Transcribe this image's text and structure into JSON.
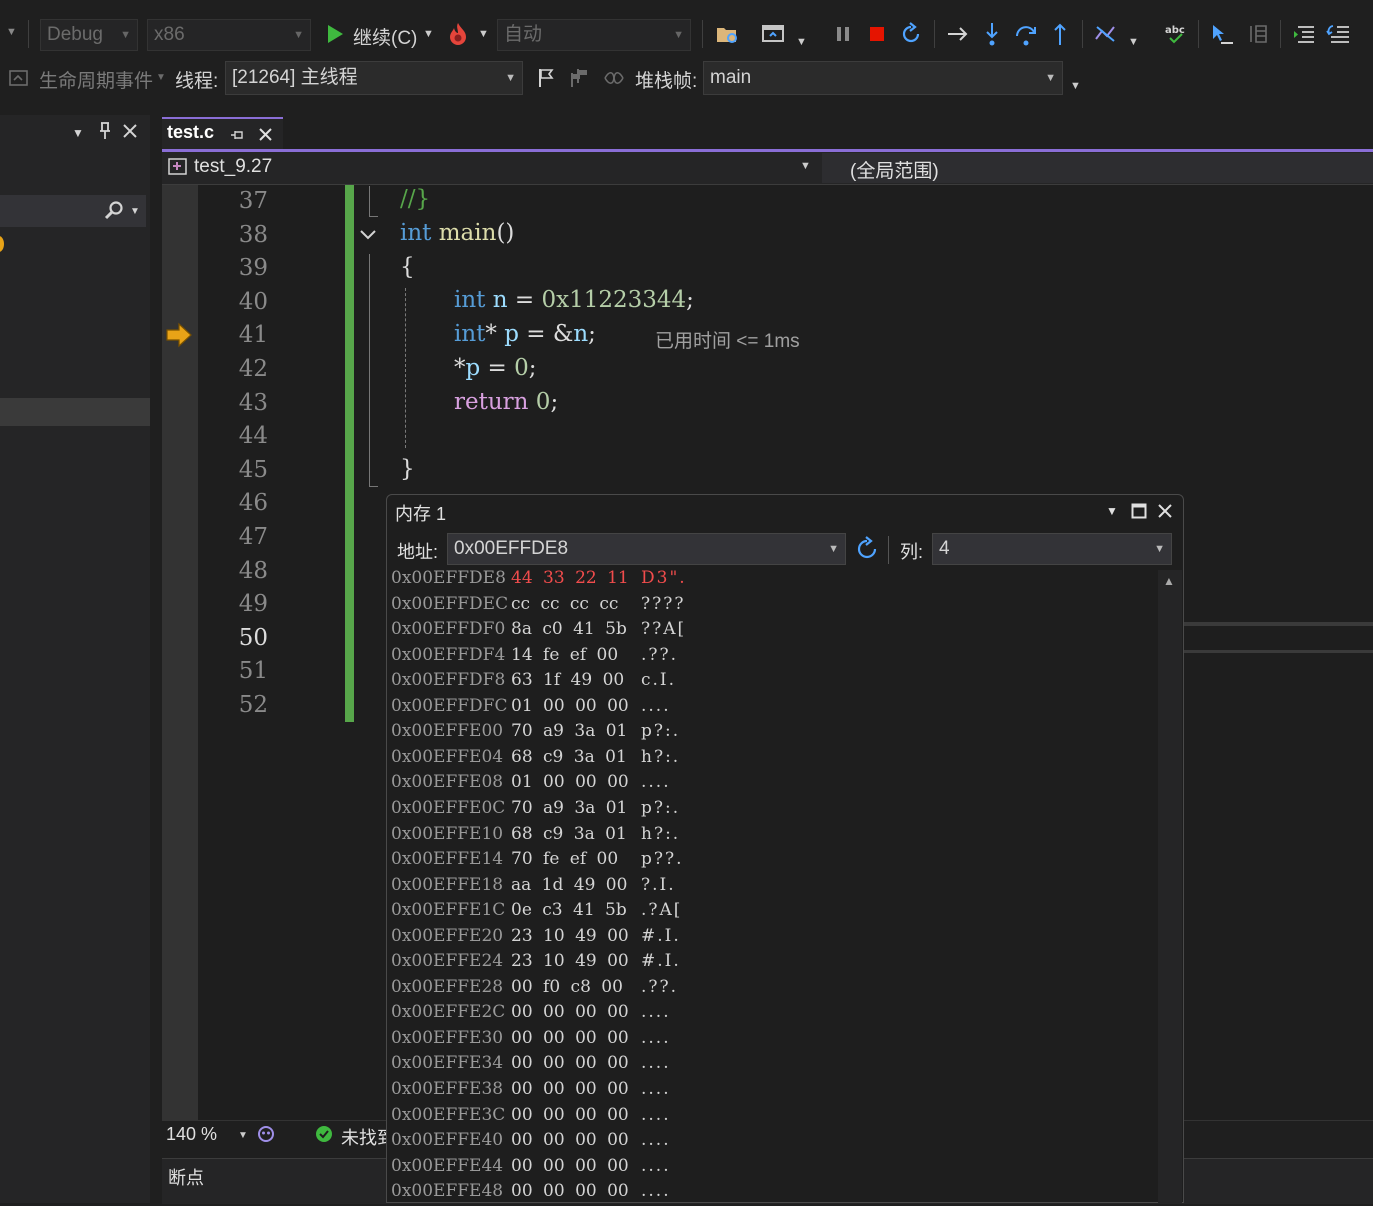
{
  "toolbar1": {
    "config": "Debug",
    "platform": "x86",
    "continue_label": "继续(C)",
    "auto_label": "自动"
  },
  "toolbar2": {
    "lifecycle_label": "生命周期事件",
    "thread_label": "线程:",
    "thread_value": "[21264] 主线程",
    "stackframe_label": "堆栈帧:",
    "stackframe_value": "main"
  },
  "editor": {
    "tab_label": "test.c",
    "project": "test_9.27",
    "scope": "(全局范围)",
    "lines": [
      {
        "n": "37"
      },
      {
        "n": "38"
      },
      {
        "n": "39"
      },
      {
        "n": "40"
      },
      {
        "n": "41"
      },
      {
        "n": "42"
      },
      {
        "n": "43"
      },
      {
        "n": "44"
      },
      {
        "n": "45"
      },
      {
        "n": "46"
      },
      {
        "n": "47"
      },
      {
        "n": "48"
      },
      {
        "n": "49"
      },
      {
        "n": "50"
      },
      {
        "n": "51"
      },
      {
        "n": "52"
      }
    ],
    "code": {
      "l37_comment": "//}",
      "l38_kw": "int",
      "l38_fn": "main",
      "l38_parens": "()",
      "l39": "{",
      "l40_kw": "int",
      "l40_var": "n",
      "l40_eq": " = ",
      "l40_num": "0x11223344",
      "l40_semi": ";",
      "l41_kw": "int",
      "l41_star": "*",
      "l41_var": "p",
      "l41_eq": " = &",
      "l41_var2": "n",
      "l41_semi": ";",
      "l41_perf": "已用时间 <= 1ms",
      "l42_star": "*",
      "l42_var": "p",
      "l42_eq": " = ",
      "l42_num": "0",
      "l42_semi": ";",
      "l43_kw": "return",
      "l43_num": "0",
      "l43_semi": ";",
      "l45": "}"
    },
    "zoom": "140 %",
    "status_text": "未找到"
  },
  "bottom_panel": {
    "title": "断点"
  },
  "memory": {
    "title": "内存 1",
    "address_label": "地址:",
    "address_value": "0x00EFFDE8",
    "columns_label": "列:",
    "columns_value": "4",
    "rows": [
      {
        "addr": "0x00EFFDE8",
        "hex": "44 33 22 11",
        "chars": "D3\".",
        "changed": true
      },
      {
        "addr": "0x00EFFDEC",
        "hex": "cc cc cc cc",
        "chars": "????"
      },
      {
        "addr": "0x00EFFDF0",
        "hex": "8a c0 41 5b",
        "chars": "??A["
      },
      {
        "addr": "0x00EFFDF4",
        "hex": "14 fe ef 00",
        "chars": ".??."
      },
      {
        "addr": "0x00EFFDF8",
        "hex": "63 1f 49 00",
        "chars": "c.I."
      },
      {
        "addr": "0x00EFFDFC",
        "hex": "01 00 00 00",
        "chars": "...."
      },
      {
        "addr": "0x00EFFE00",
        "hex": "70 a9 3a 01",
        "chars": "p?:."
      },
      {
        "addr": "0x00EFFE04",
        "hex": "68 c9 3a 01",
        "chars": "h?:."
      },
      {
        "addr": "0x00EFFE08",
        "hex": "01 00 00 00",
        "chars": "...."
      },
      {
        "addr": "0x00EFFE0C",
        "hex": "70 a9 3a 01",
        "chars": "p?:."
      },
      {
        "addr": "0x00EFFE10",
        "hex": "68 c9 3a 01",
        "chars": "h?:."
      },
      {
        "addr": "0x00EFFE14",
        "hex": "70 fe ef 00",
        "chars": "p??."
      },
      {
        "addr": "0x00EFFE18",
        "hex": "aa 1d 49 00",
        "chars": "?.I."
      },
      {
        "addr": "0x00EFFE1C",
        "hex": "0e c3 41 5b",
        "chars": ".?A["
      },
      {
        "addr": "0x00EFFE20",
        "hex": "23 10 49 00",
        "chars": "#.I."
      },
      {
        "addr": "0x00EFFE24",
        "hex": "23 10 49 00",
        "chars": "#.I."
      },
      {
        "addr": "0x00EFFE28",
        "hex": "00 f0 c8 00",
        "chars": ".??."
      },
      {
        "addr": "0x00EFFE2C",
        "hex": "00 00 00 00",
        "chars": "...."
      },
      {
        "addr": "0x00EFFE30",
        "hex": "00 00 00 00",
        "chars": "...."
      },
      {
        "addr": "0x00EFFE34",
        "hex": "00 00 00 00",
        "chars": "...."
      },
      {
        "addr": "0x00EFFE38",
        "hex": "00 00 00 00",
        "chars": "...."
      },
      {
        "addr": "0x00EFFE3C",
        "hex": "00 00 00 00",
        "chars": "...."
      },
      {
        "addr": "0x00EFFE40",
        "hex": "00 00 00 00",
        "chars": "...."
      },
      {
        "addr": "0x00EFFE44",
        "hex": "00 00 00 00",
        "chars": "...."
      },
      {
        "addr": "0x00EFFE48",
        "hex": "00 00 00 00",
        "chars": "...."
      }
    ]
  },
  "colors": {
    "accent": "#8a6ed6",
    "change_bar": "#57a64a",
    "changed_value": "#f14c4c",
    "stop": "#e51400",
    "continue": "#3fb93f",
    "exec_arrow": "#e8a317"
  },
  "icons": [
    "continue-icon",
    "hot-reload-icon",
    "break-all-icon",
    "stop-icon",
    "restart-icon",
    "show-next-statement-icon",
    "step-into-icon",
    "step-over-icon",
    "step-out-icon",
    "flag-icon",
    "pin-icon",
    "close-icon",
    "search-icon",
    "refresh-icon",
    "execution-arrow-icon",
    "ok-icon"
  ]
}
